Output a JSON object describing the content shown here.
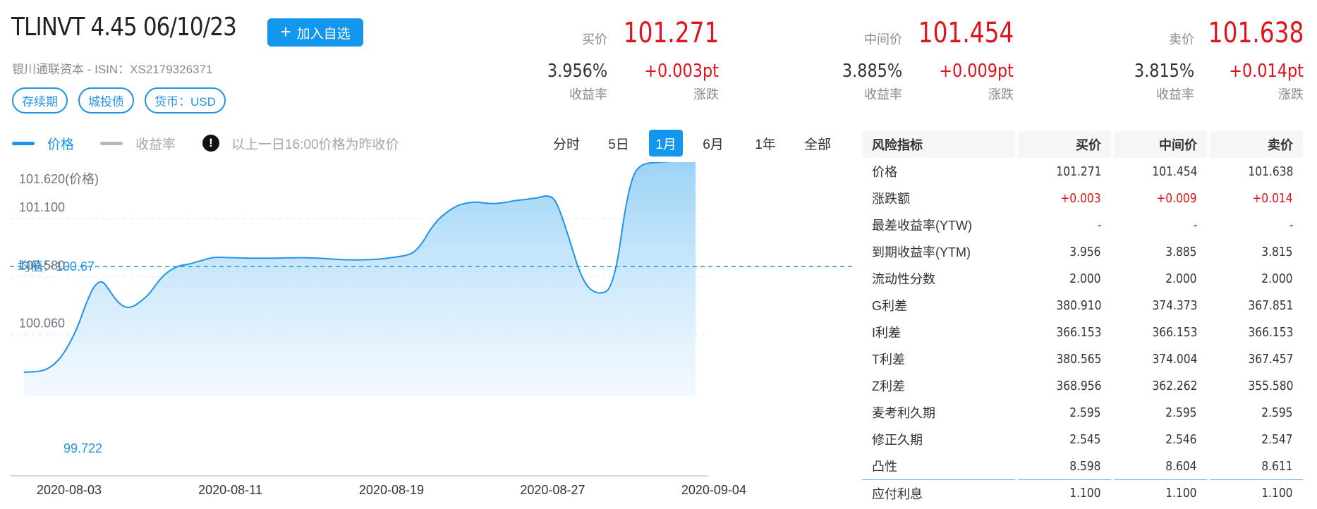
{
  "header": {
    "bond_title": "TLINVT 4.45 06/10/23",
    "watch_button": "加入自选",
    "issuer_line": "银川通联资本 - ISIN：XS2179326371",
    "tags": [
      "存续期",
      "城投债",
      "货币：USD"
    ]
  },
  "quotes": [
    {
      "label": "买价",
      "price": "101.271",
      "yield": "3.956%",
      "yield_label": "收益率",
      "change": "+0.003pt",
      "change_label": "涨跌"
    },
    {
      "label": "中间价",
      "price": "101.454",
      "yield": "3.885%",
      "yield_label": "收益率",
      "change": "+0.009pt",
      "change_label": "涨跌"
    },
    {
      "label": "卖价",
      "price": "101.638",
      "yield": "3.815%",
      "yield_label": "收益率",
      "change": "+0.014pt",
      "change_label": "涨跌"
    }
  ],
  "chart_toolbar": {
    "legend_price": "价格",
    "legend_yield": "收益率",
    "note": "以上一日16:00价格为昨收价",
    "ranges": [
      "分时",
      "5日",
      "1月",
      "6月",
      "1年",
      "全部"
    ],
    "active_range": "1月"
  },
  "chart_data": {
    "type": "area",
    "series": [
      {
        "name": "价格",
        "color": "#1f93e6"
      }
    ],
    "x": [
      0,
      1,
      2,
      3,
      4,
      5,
      6,
      7,
      8,
      9,
      10,
      11,
      12,
      13,
      14,
      15,
      16,
      17,
      18,
      19,
      20,
      21,
      22,
      23,
      24,
      25,
      26,
      27,
      28,
      29,
      30,
      31,
      32,
      33,
      34,
      35,
      36,
      37,
      38,
      39,
      40,
      41,
      42,
      43,
      44,
      45,
      46,
      47,
      48,
      49,
      50,
      51,
      52,
      53,
      54,
      55,
      56,
      57,
      58,
      59,
      60,
      61,
      62,
      63,
      64,
      65,
      66,
      67,
      68,
      69,
      70,
      71,
      72,
      73,
      74,
      75,
      76,
      77,
      78,
      79,
      80,
      81,
      82,
      83,
      84,
      85,
      86,
      87,
      88,
      89,
      90,
      91,
      92,
      93,
      94,
      95,
      96,
      97,
      98,
      99,
      100
    ],
    "y": [
      99.722,
      99.725,
      99.73,
      99.75,
      99.8,
      99.88,
      100.0,
      100.15,
      100.35,
      100.5,
      100.55,
      100.45,
      100.35,
      100.3,
      100.31,
      100.36,
      100.42,
      100.52,
      100.6,
      100.65,
      100.68,
      100.69,
      100.71,
      100.73,
      100.75,
      100.755,
      100.75,
      100.75,
      100.748,
      100.745,
      100.745,
      100.745,
      100.745,
      100.748,
      100.748,
      100.75,
      100.75,
      100.748,
      100.745,
      100.74,
      100.735,
      100.732,
      100.73,
      100.73,
      100.732,
      100.735,
      100.74,
      100.75,
      100.76,
      100.77,
      100.8,
      100.88,
      101.0,
      101.09,
      101.15,
      101.2,
      101.23,
      101.245,
      101.25,
      101.24,
      101.235,
      101.24,
      101.25,
      101.265,
      101.27,
      101.28,
      101.29,
      101.31,
      101.28,
      101.1,
      100.88,
      100.65,
      100.5,
      100.44,
      100.43,
      100.46,
      100.7,
      101.2,
      101.5,
      101.58,
      101.6,
      101.605,
      101.61,
      101.615,
      101.62,
      101.62,
      101.62
    ],
    "x_ticks": [
      "2020-08-03",
      "2020-08-11",
      "2020-08-19",
      "2020-08-27",
      "2020-09-04"
    ],
    "y_ticks": [
      "100.060",
      "100.580",
      "101.100"
    ],
    "max_label": "101.620(价格)",
    "min_label": "99.722",
    "avg_label": "均值：100.67",
    "avg_value": 100.67,
    "ylim": [
      99.722,
      101.62
    ],
    "grid": true
  },
  "risk_table": {
    "headers": [
      "风险指标",
      "买价",
      "中间价",
      "卖价"
    ],
    "rows": [
      {
        "name": "价格",
        "bid": "101.271",
        "mid": "101.454",
        "ask": "101.638",
        "red": false
      },
      {
        "name": "涨跌额",
        "bid": "+0.003",
        "mid": "+0.009",
        "ask": "+0.014",
        "red": true
      },
      {
        "name": "最差收益率(YTW)",
        "bid": "-",
        "mid": "-",
        "ask": "-",
        "red": false
      },
      {
        "name": "到期收益率(YTM)",
        "bid": "3.956",
        "mid": "3.885",
        "ask": "3.815",
        "red": false
      },
      {
        "name": "流动性分数",
        "bid": "2.000",
        "mid": "2.000",
        "ask": "2.000",
        "red": false
      },
      {
        "name": "G利差",
        "bid": "380.910",
        "mid": "374.373",
        "ask": "367.851",
        "red": false
      },
      {
        "name": "I利差",
        "bid": "366.153",
        "mid": "366.153",
        "ask": "366.153",
        "red": false
      },
      {
        "name": "T利差",
        "bid": "380.565",
        "mid": "374.004",
        "ask": "367.457",
        "red": false
      },
      {
        "name": "Z利差",
        "bid": "368.956",
        "mid": "362.262",
        "ask": "355.580",
        "red": false
      },
      {
        "name": "麦考利久期",
        "bid": "2.595",
        "mid": "2.595",
        "ask": "2.595",
        "red": false
      },
      {
        "name": "修正久期",
        "bid": "2.545",
        "mid": "2.546",
        "ask": "2.547",
        "red": false
      },
      {
        "name": "凸性",
        "bid": "8.598",
        "mid": "8.604",
        "ask": "8.611",
        "red": false
      },
      {
        "name": "应付利息",
        "bid": "1.100",
        "mid": "1.100",
        "ask": "1.100",
        "red": false
      }
    ]
  }
}
